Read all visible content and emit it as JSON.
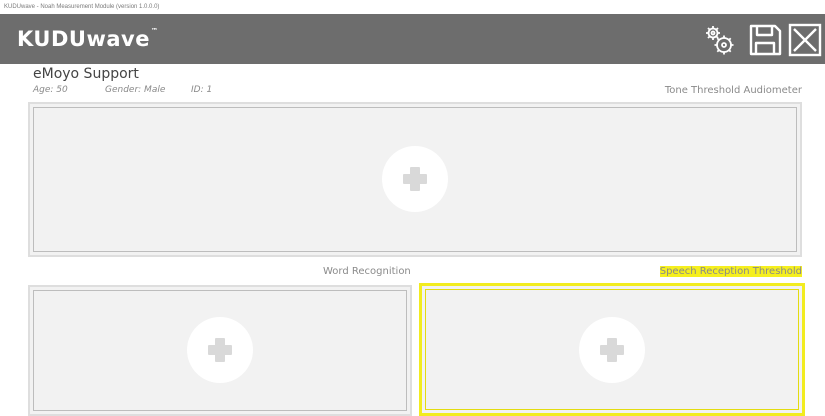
{
  "window": {
    "title": "KUDUwave - Noah Measurement Module (version 1.0.0.0)"
  },
  "header": {
    "logo": "KUDUwave",
    "logo_mark": "™",
    "settings_icon": "gears-icon",
    "save_icon": "floppy-disk-icon",
    "close_icon": "close-x-icon"
  },
  "patient": {
    "name": "eMoyo Support",
    "age": "Age: 50",
    "gender": "Gender: Male",
    "id": "ID: 1"
  },
  "sections": {
    "tone": {
      "label": "Tone Threshold Audiometer"
    },
    "word": {
      "label": "Word Recognition"
    },
    "speech": {
      "label": "Speech Reception Threshold"
    }
  },
  "colors": {
    "header_bg": "#6d6d6d",
    "panel_bg": "#f2f2f2",
    "highlight": "#f2ec1f"
  }
}
